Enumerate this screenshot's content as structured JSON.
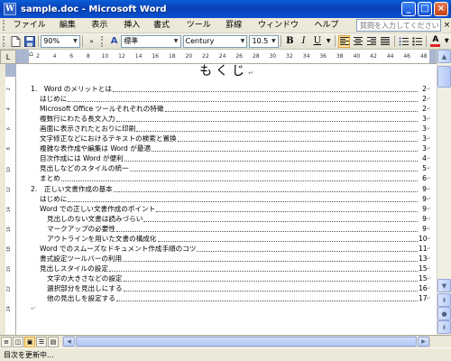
{
  "window": {
    "title": "sample.doc - Microsoft Word",
    "app_icon": "word-icon",
    "buttons": {
      "minimize": "_",
      "maximize": "□",
      "close": "×"
    }
  },
  "menu": {
    "items": [
      "ファイル(F)",
      "編集(E)",
      "表示(V)",
      "挿入(I)",
      "書式(O)",
      "ツール(T)",
      "罫線(A)",
      "ウィンドウ(W)",
      "ヘルプ(H)"
    ],
    "help_placeholder": "質問を入力してください",
    "close_glyph": "×"
  },
  "toolbar": {
    "zoom": "90%",
    "style": "標準",
    "font": "Century",
    "size": "10.5",
    "bold": "B",
    "italic": "I",
    "underline": "U",
    "font_color_letter": "A"
  },
  "ruler": {
    "ticks": [
      "2",
      "4",
      "6",
      "8",
      "10",
      "12",
      "14",
      "16",
      "18",
      "20",
      "22",
      "24",
      "26",
      "28",
      "30",
      "32",
      "34",
      "36",
      "38",
      "40",
      "42",
      "44",
      "46",
      "48"
    ],
    "vticks": [
      "2",
      "4",
      "6",
      "8",
      "10",
      "12",
      "14",
      "16",
      "18",
      "20",
      "22",
      "24"
    ]
  },
  "document": {
    "title": "もくじ",
    "paragraph_mark": "↵",
    "toc": [
      {
        "level": 0,
        "text": "1.　Word のメリットとは",
        "page": "2"
      },
      {
        "level": 1,
        "text": "はじめに",
        "page": "2"
      },
      {
        "level": 1,
        "text": "Microsoft Office ツールそれぞれの特徴",
        "page": "2"
      },
      {
        "level": 1,
        "text": "複数行にわたる長文入力",
        "page": "3"
      },
      {
        "level": 1,
        "text": "画面に表示されたとおりに印刷",
        "page": "3"
      },
      {
        "level": 1,
        "text": "文字修正などにおけるテキストの検索と置換",
        "page": "3"
      },
      {
        "level": 1,
        "text": "複雑な表作成や編集は Word が最適",
        "page": "3"
      },
      {
        "level": 1,
        "text": "目次作成には Word が便利",
        "page": "4"
      },
      {
        "level": 1,
        "text": "見出しなどのスタイルの統一",
        "page": "5"
      },
      {
        "level": 1,
        "text": "まとめ",
        "page": "6"
      },
      {
        "level": 0,
        "text": "2.　正しい文書作成の基本",
        "page": "9"
      },
      {
        "level": 1,
        "text": "はじめに",
        "page": "9"
      },
      {
        "level": 1,
        "text": "Word での正しい文書作成のポイント",
        "page": "9"
      },
      {
        "level": 2,
        "text": "見出しのない文書は読みづらい",
        "page": "9"
      },
      {
        "level": 2,
        "text": "マークアップの必要性",
        "page": "9"
      },
      {
        "level": 2,
        "text": "アウトラインを用いた文書の構成化",
        "page": "10"
      },
      {
        "level": 1,
        "text": "Word でのスムーズなドキュメント作成手順のコツ",
        "page": "11"
      },
      {
        "level": 1,
        "text": "書式設定ツールバーの利用",
        "page": "13"
      },
      {
        "level": 1,
        "text": "見出しスタイルの設定",
        "page": "15"
      },
      {
        "level": 2,
        "text": "文字の大きさなどの設定",
        "page": "15"
      },
      {
        "level": 2,
        "text": "選択部分を見出しにする",
        "page": "16"
      },
      {
        "level": 2,
        "text": "他の見出しを設定する",
        "page": "17"
      }
    ]
  },
  "status": {
    "text": "目次を更新中..."
  }
}
